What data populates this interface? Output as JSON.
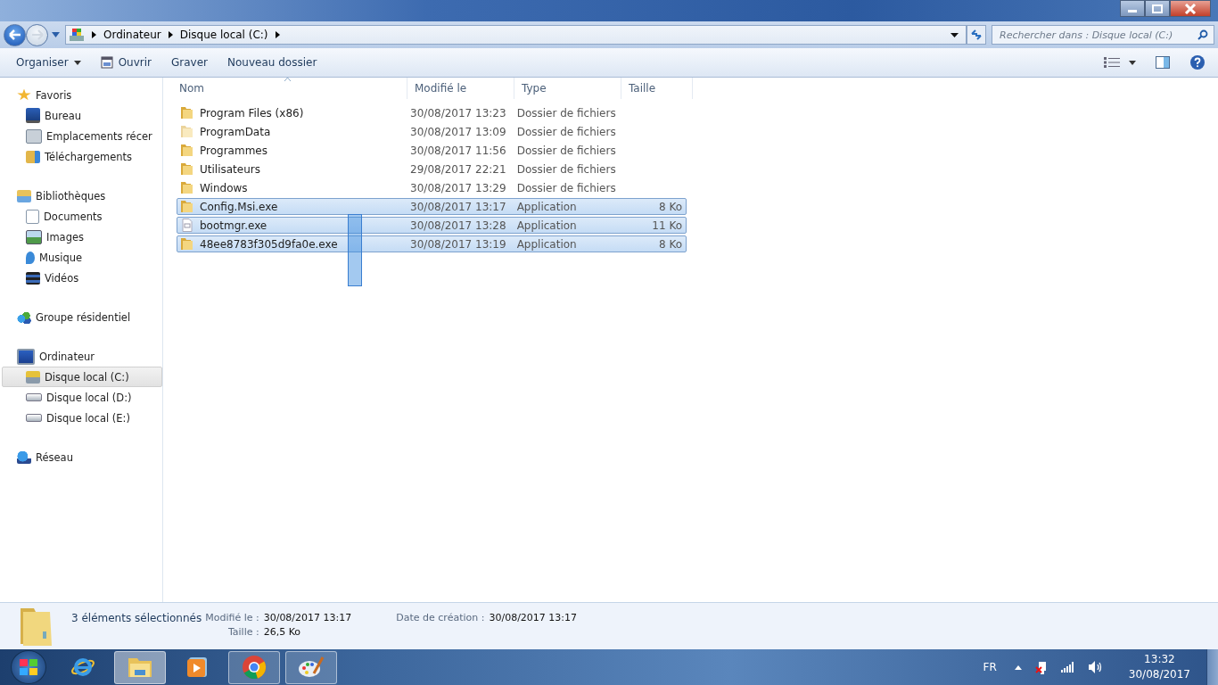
{
  "address": {
    "crumbs": [
      "Ordinateur",
      "Disque local (C:)"
    ]
  },
  "search": {
    "placeholder": "Rechercher dans : Disque local (C:)"
  },
  "toolbar": {
    "buttons": [
      {
        "label": "Organiser",
        "kind": "menu"
      },
      {
        "label": "Ouvrir",
        "kind": "open"
      },
      {
        "label": "Graver",
        "kind": "plain"
      },
      {
        "label": "Nouveau dossier",
        "kind": "plain"
      }
    ]
  },
  "sidebar": {
    "groups": [
      {
        "label": "Favoris",
        "kind": "star",
        "selected": false,
        "children": [
          {
            "label": "Bureau",
            "kind": "desktop",
            "selected": false
          },
          {
            "label": "Emplacements récer",
            "kind": "recent",
            "selected": false
          },
          {
            "label": "Téléchargements",
            "kind": "downloads",
            "selected": false
          }
        ]
      },
      {
        "label": "Bibliothèques",
        "kind": "library",
        "selected": false,
        "children": [
          {
            "label": "Documents",
            "kind": "document",
            "selected": false
          },
          {
            "label": "Images",
            "kind": "picture",
            "selected": false
          },
          {
            "label": "Musique",
            "kind": "music",
            "selected": false
          },
          {
            "label": "Vidéos",
            "kind": "video",
            "selected": false
          }
        ]
      },
      {
        "label": "Groupe résidentiel",
        "kind": "homegroup",
        "selected": false
      },
      {
        "label": "Ordinateur",
        "kind": "computer",
        "selected": false,
        "children": [
          {
            "label": "Disque local (C:)",
            "kind": "system-drive",
            "selected": true
          },
          {
            "label": "Disque local (D:)",
            "kind": "drive",
            "selected": false
          },
          {
            "label": "Disque local (E:)",
            "kind": "drive",
            "selected": false
          }
        ]
      },
      {
        "label": "Réseau",
        "kind": "network",
        "selected": false
      }
    ]
  },
  "table": {
    "columns": [
      "Nom",
      "Modifié le",
      "Type",
      "Taille"
    ],
    "rows": [
      {
        "name": "Program Files (x86)",
        "modified": "30/08/2017 13:23",
        "type": "Dossier de fichiers",
        "kind": "folder",
        "selected": false
      },
      {
        "name": "ProgramData",
        "modified": "30/08/2017 13:09",
        "type": "Dossier de fichiers",
        "kind": "hidden-folder",
        "selected": false
      },
      {
        "name": "Programmes",
        "modified": "30/08/2017 11:56",
        "type": "Dossier de fichiers",
        "kind": "folder",
        "selected": false
      },
      {
        "name": "Utilisateurs",
        "modified": "29/08/2017 22:21",
        "type": "Dossier de fichiers",
        "kind": "folder",
        "selected": false
      },
      {
        "name": "Windows",
        "modified": "30/08/2017 13:29",
        "type": "Dossier de fichiers",
        "kind": "folder",
        "selected": false
      },
      {
        "name": "Config.Msi.exe",
        "modified": "30/08/2017 13:17",
        "type": "Application",
        "size": "8 Ko",
        "kind": "folder",
        "selected": true
      },
      {
        "name": "bootmgr.exe",
        "modified": "30/08/2017 13:28",
        "type": "Application",
        "size": "11 Ko",
        "kind": "file",
        "selected": true
      },
      {
        "name": "48ee8783f305d9fa0e.exe",
        "modified": "30/08/2017 13:19",
        "type": "Application",
        "size": "8 Ko",
        "kind": "folder",
        "selected": true
      }
    ]
  },
  "details": {
    "count": "3 éléments sélectionnés",
    "fields": [
      {
        "label": "Modifié le :",
        "value": "30/08/2017 13:17"
      },
      {
        "label": "Taille :",
        "value": "26,5 Ko"
      }
    ],
    "created": {
      "label": "Date de création :",
      "value": "30/08/2017 13:17"
    }
  },
  "taskbar": {
    "apps": [
      {
        "kind": "browser-e",
        "open": false,
        "selected": false
      },
      {
        "kind": "explorer",
        "open": true,
        "selected": true
      },
      {
        "kind": "media",
        "open": false,
        "selected": false
      },
      {
        "kind": "chrome",
        "open": true,
        "selected": false
      },
      {
        "kind": "paint",
        "open": true,
        "selected": false
      }
    ],
    "language": "FR",
    "time": "13:32",
    "date": "30/08/2017"
  }
}
